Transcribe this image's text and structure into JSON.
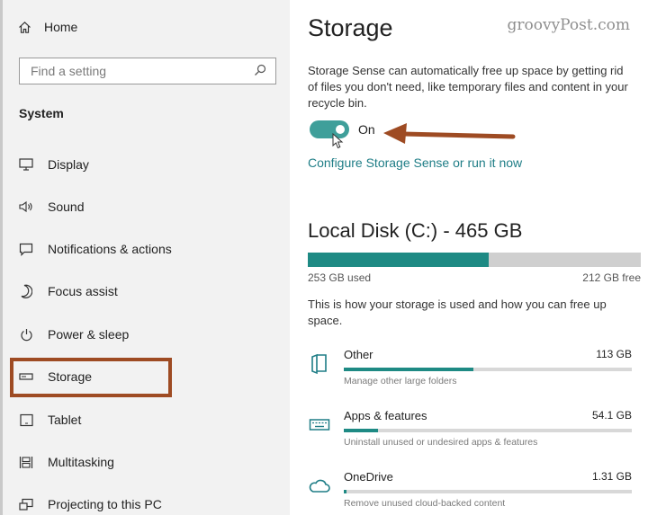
{
  "sidebar": {
    "home": "Home",
    "search_placeholder": "Find a setting",
    "section": "System",
    "items": [
      {
        "label": "Display",
        "icon": "monitor-icon"
      },
      {
        "label": "Sound",
        "icon": "speaker-icon"
      },
      {
        "label": "Notifications & actions",
        "icon": "message-icon"
      },
      {
        "label": "Focus assist",
        "icon": "moon-icon"
      },
      {
        "label": "Power & sleep",
        "icon": "power-icon"
      },
      {
        "label": "Storage",
        "icon": "drive-icon"
      },
      {
        "label": "Tablet",
        "icon": "tablet-icon"
      },
      {
        "label": "Multitasking",
        "icon": "multitask-icon"
      },
      {
        "label": "Projecting to this PC",
        "icon": "project-icon"
      }
    ],
    "selected": "Storage"
  },
  "main": {
    "title": "Storage",
    "watermark": "groovyPost.com",
    "description": "Storage Sense can automatically free up space by getting rid of files you don't need, like temporary files and content in your recycle bin.",
    "toggle_state": "On",
    "toggle_on": true,
    "link": "Configure Storage Sense or run it now",
    "disk_title": "Local Disk (C:) - 465 GB",
    "used_label": "253 GB used",
    "free_label": "212 GB free",
    "used_fraction": 0.544,
    "usage_description": "This is how your storage is used and how you can free up space.",
    "categories": [
      {
        "name": "Other",
        "size": "113 GB",
        "subtitle": "Manage other large folders",
        "fraction": 0.45,
        "icon": "folder-icon"
      },
      {
        "name": "Apps & features",
        "size": "54.1 GB",
        "subtitle": "Uninstall unused or undesired apps & features",
        "fraction": 0.12,
        "icon": "keyboard-icon"
      },
      {
        "name": "OneDrive",
        "size": "1.31 GB",
        "subtitle": "Remove unused cloud-backed content",
        "fraction": 0.01,
        "icon": "cloud-icon"
      }
    ]
  },
  "colors": {
    "accent": "#1e8a84",
    "link": "#1e7d86",
    "highlight": "#9e4b23",
    "sidebar_bg": "#f2f2f2"
  }
}
